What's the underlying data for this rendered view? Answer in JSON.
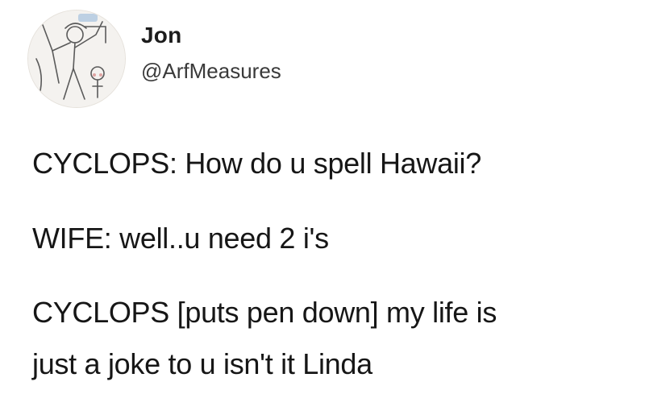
{
  "tweet": {
    "author": {
      "display_name": "Jon",
      "handle": "@ArfMeasures",
      "avatar_icon": "sketch-avatar-icon"
    },
    "lines": [
      "CYCLOPS: How do u spell Hawaii?",
      "WIFE: well..u need 2 i's",
      "CYCLOPS [puts pen down] my life is",
      "just a joke to u isn't it Linda"
    ]
  }
}
